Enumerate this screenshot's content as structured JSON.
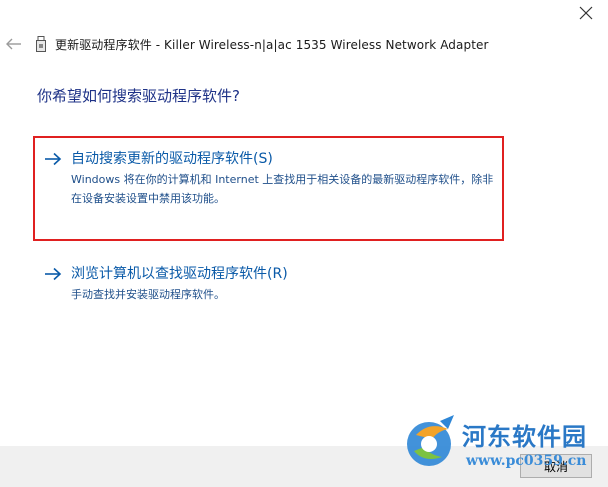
{
  "window": {
    "title": "更新驱动程序软件 - Killer Wireless-n|a|ac 1535 Wireless Network Adapter",
    "close_icon": "close-icon",
    "back_icon": "back-arrow-icon",
    "device_icon": "usb-device-icon"
  },
  "main": {
    "question": "你希望如何搜索驱动程序软件?",
    "options": [
      {
        "title": "自动搜索更新的驱动程序软件(S)",
        "description": "Windows 将在你的计算机和 Internet 上查找用于相关设备的最新驱动程序软件，除非在设备安装设置中禁用该功能。",
        "highlighted": true
      },
      {
        "title": "浏览计算机以查找驱动程序软件(R)",
        "description": "手动查找并安装驱动程序软件。",
        "highlighted": false
      }
    ]
  },
  "footer": {
    "cancel_label": "取消"
  },
  "watermark": {
    "name": "河东软件园",
    "url": "www.pc0359.cn"
  },
  "colors": {
    "question": "#1e3287",
    "link": "#0a5aa8",
    "highlight_border": "#e02020",
    "footer_bg": "#f0f0f0"
  }
}
